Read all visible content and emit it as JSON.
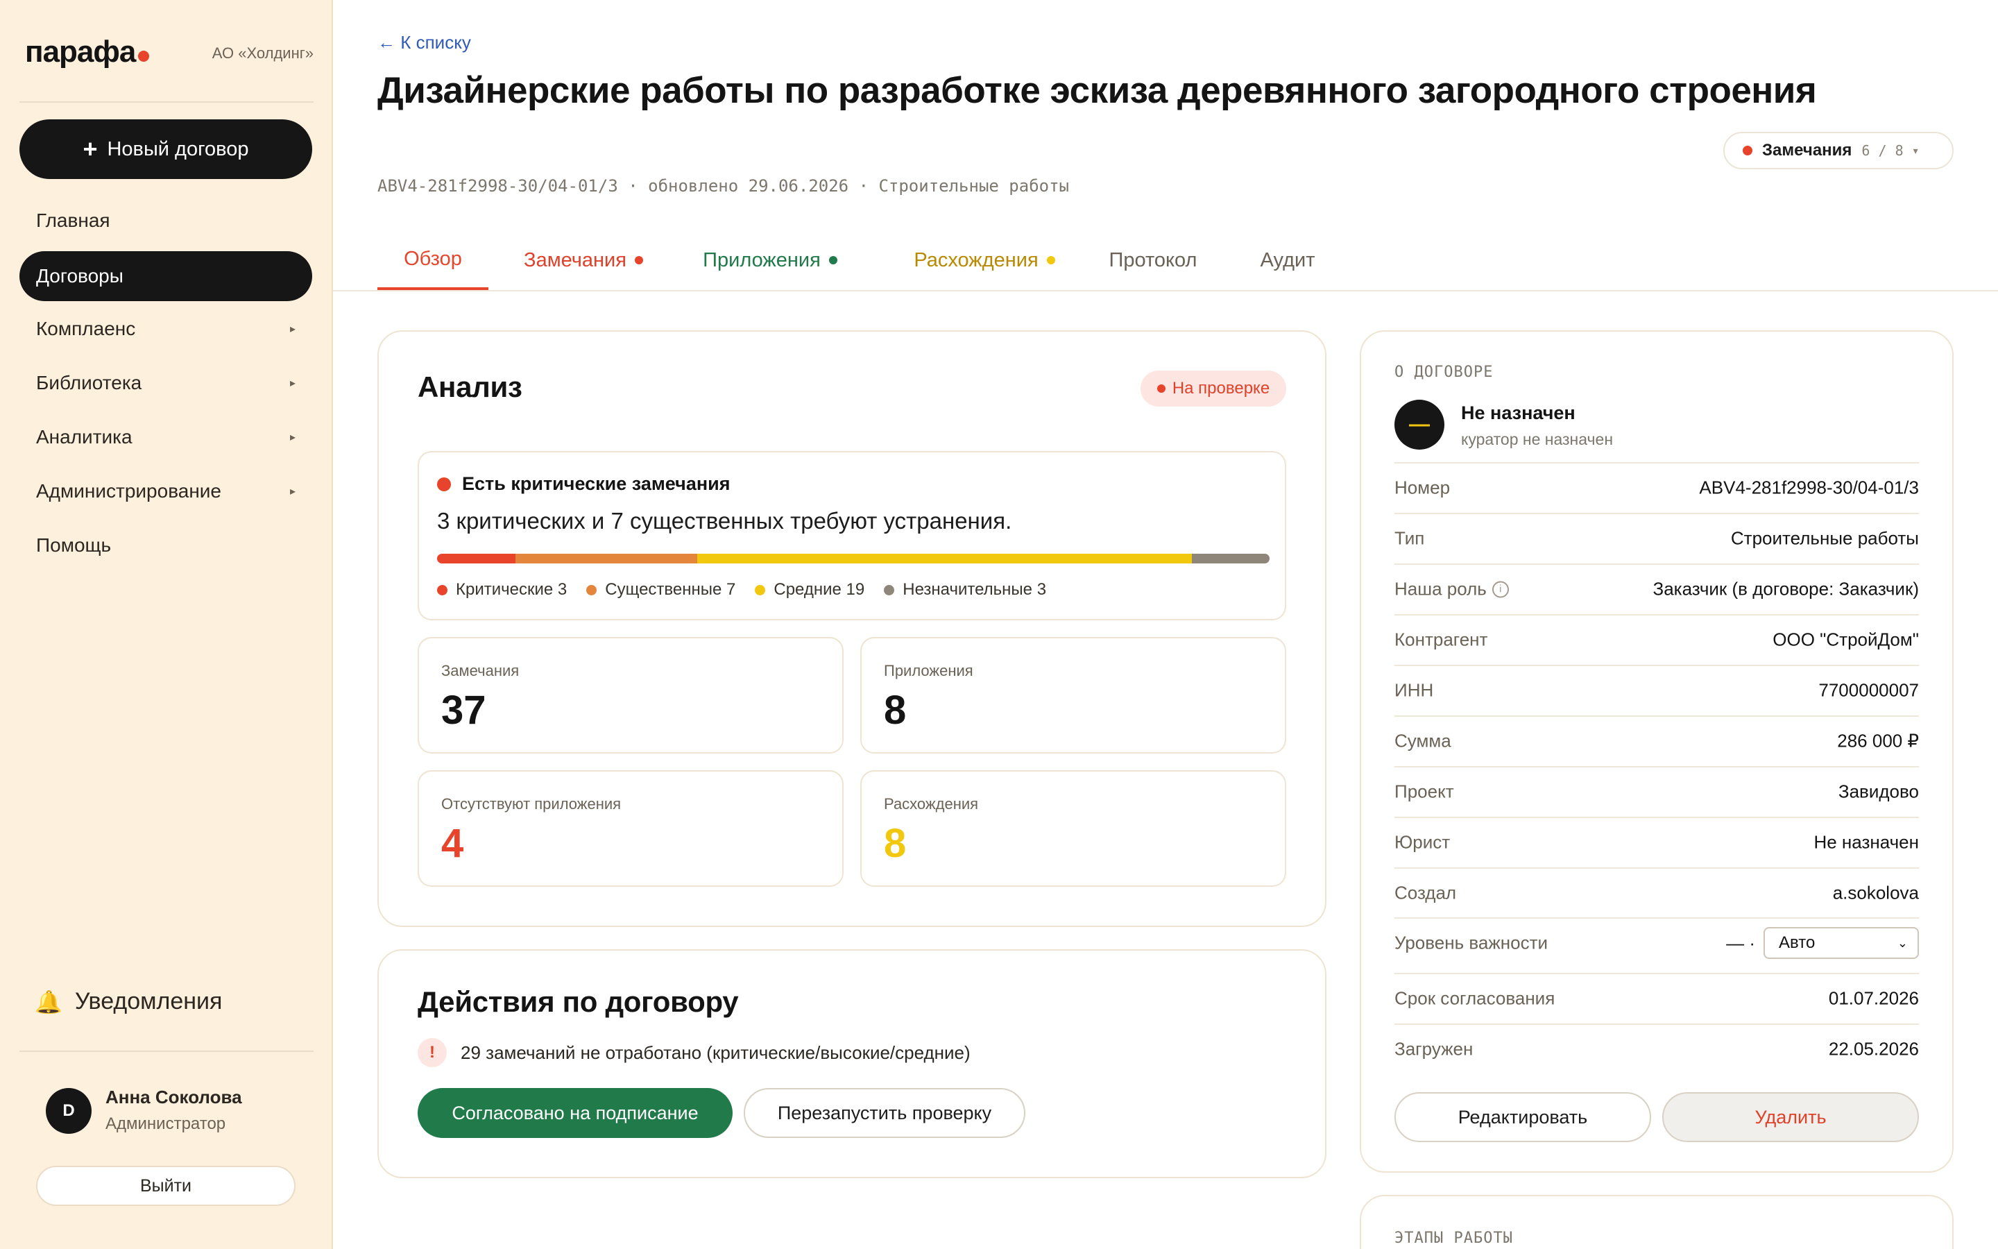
{
  "sidebar": {
    "logo": "парафа",
    "org": "АО «Холдинг»",
    "new_button": "Новый договор",
    "nav": [
      {
        "label": "Главная",
        "has_caret": false
      },
      {
        "label": "Договоры",
        "has_caret": false,
        "active": true
      },
      {
        "label": "Комплаенс",
        "has_caret": true
      },
      {
        "label": "Библиотека",
        "has_caret": true
      },
      {
        "label": "Аналитика",
        "has_caret": true
      },
      {
        "label": "Администрирование",
        "has_caret": true
      },
      {
        "label": "Помощь",
        "has_caret": false
      }
    ],
    "notifications": "Уведомления",
    "user": {
      "initial": "D",
      "name": "Анна Соколова",
      "role": "Администратор"
    },
    "logout": "Выйти"
  },
  "header": {
    "back": "← К списку",
    "title": "Дизайнерские работы по разработке эскиза деревянного загородного строения",
    "meta": "ABV4-281f2998-30/04-01/3 · обновлено 29.06.2026 · Строительные работы",
    "remarks_pill": {
      "label": "Замечания",
      "count": "6 / 8"
    }
  },
  "tabs": [
    {
      "label": "Обзор",
      "color": "#e8442c",
      "active": true,
      "dot": null
    },
    {
      "label": "Замечания",
      "color": "#e0412a",
      "dot": "#e8442c"
    },
    {
      "label": "Приложения",
      "color": "#217a4a",
      "dot": "#217a4a"
    },
    {
      "label": "Расхождения",
      "color": "#b88a00",
      "dot": "#f2c80f"
    },
    {
      "label": "Протокол",
      "color": "#6b6256",
      "dot": null
    },
    {
      "label": "Аудит",
      "color": "#6b6256",
      "dot": null
    }
  ],
  "analysis": {
    "title": "Анализ",
    "status": "На проверке",
    "alert_title": "Есть критические замечания",
    "alert_text": "3 критических и 7 существенных требуют устранения.",
    "severity": [
      {
        "label": "Критические",
        "count": 3,
        "color": "#e8442c"
      },
      {
        "label": "Существенные",
        "count": 7,
        "color": "#e3863c"
      },
      {
        "label": "Средние",
        "count": 19,
        "color": "#f2c80f"
      },
      {
        "label": "Незначительные",
        "count": 3,
        "color": "#8f867a"
      }
    ],
    "stats": [
      {
        "label": "Замечания",
        "value": "37",
        "color": "#141414"
      },
      {
        "label": "Приложения",
        "value": "8",
        "color": "#141414"
      },
      {
        "label": "Отсутствуют приложения",
        "value": "4",
        "color": "#e8442c"
      },
      {
        "label": "Расхождения",
        "value": "8",
        "color": "#f2c80f"
      }
    ]
  },
  "actions": {
    "title": "Действия по договору",
    "warning": "29 замечаний не отработано (критические/высокие/средние)",
    "approve": "Согласовано на подписание",
    "restart": "Перезапустить проверку"
  },
  "info": {
    "section": "О ДОГОВОРЕ",
    "curator": {
      "name": "Не назначен",
      "sub": "куратор не назначен"
    },
    "rows": [
      {
        "k": "Номер",
        "v": "ABV4-281f2998-30/04-01/3"
      },
      {
        "k": "Тип",
        "v": "Строительные работы"
      },
      {
        "k": "Наша роль",
        "v": "Заказчик (в договоре: Заказчик)",
        "info": true
      },
      {
        "k": "Контрагент",
        "v": "ООО \"СтройДом\""
      },
      {
        "k": "ИНН",
        "v": "7700000007"
      },
      {
        "k": "Сумма",
        "v": "286 000 ₽"
      },
      {
        "k": "Проект",
        "v": "Завидово"
      },
      {
        "k": "Юрист",
        "v": "Не назначен"
      },
      {
        "k": "Создал",
        "v": "a.sokolova"
      }
    ],
    "importance": {
      "k": "Уровень важности",
      "prefix": "— ·",
      "select": "Авто"
    },
    "rows_after": [
      {
        "k": "Срок согласования",
        "v": "01.07.2026"
      },
      {
        "k": "Загружен",
        "v": "22.05.2026"
      }
    ],
    "edit": "Редактировать",
    "delete": "Удалить",
    "stages_label": "ЭТАПЫ РАБОТЫ"
  }
}
